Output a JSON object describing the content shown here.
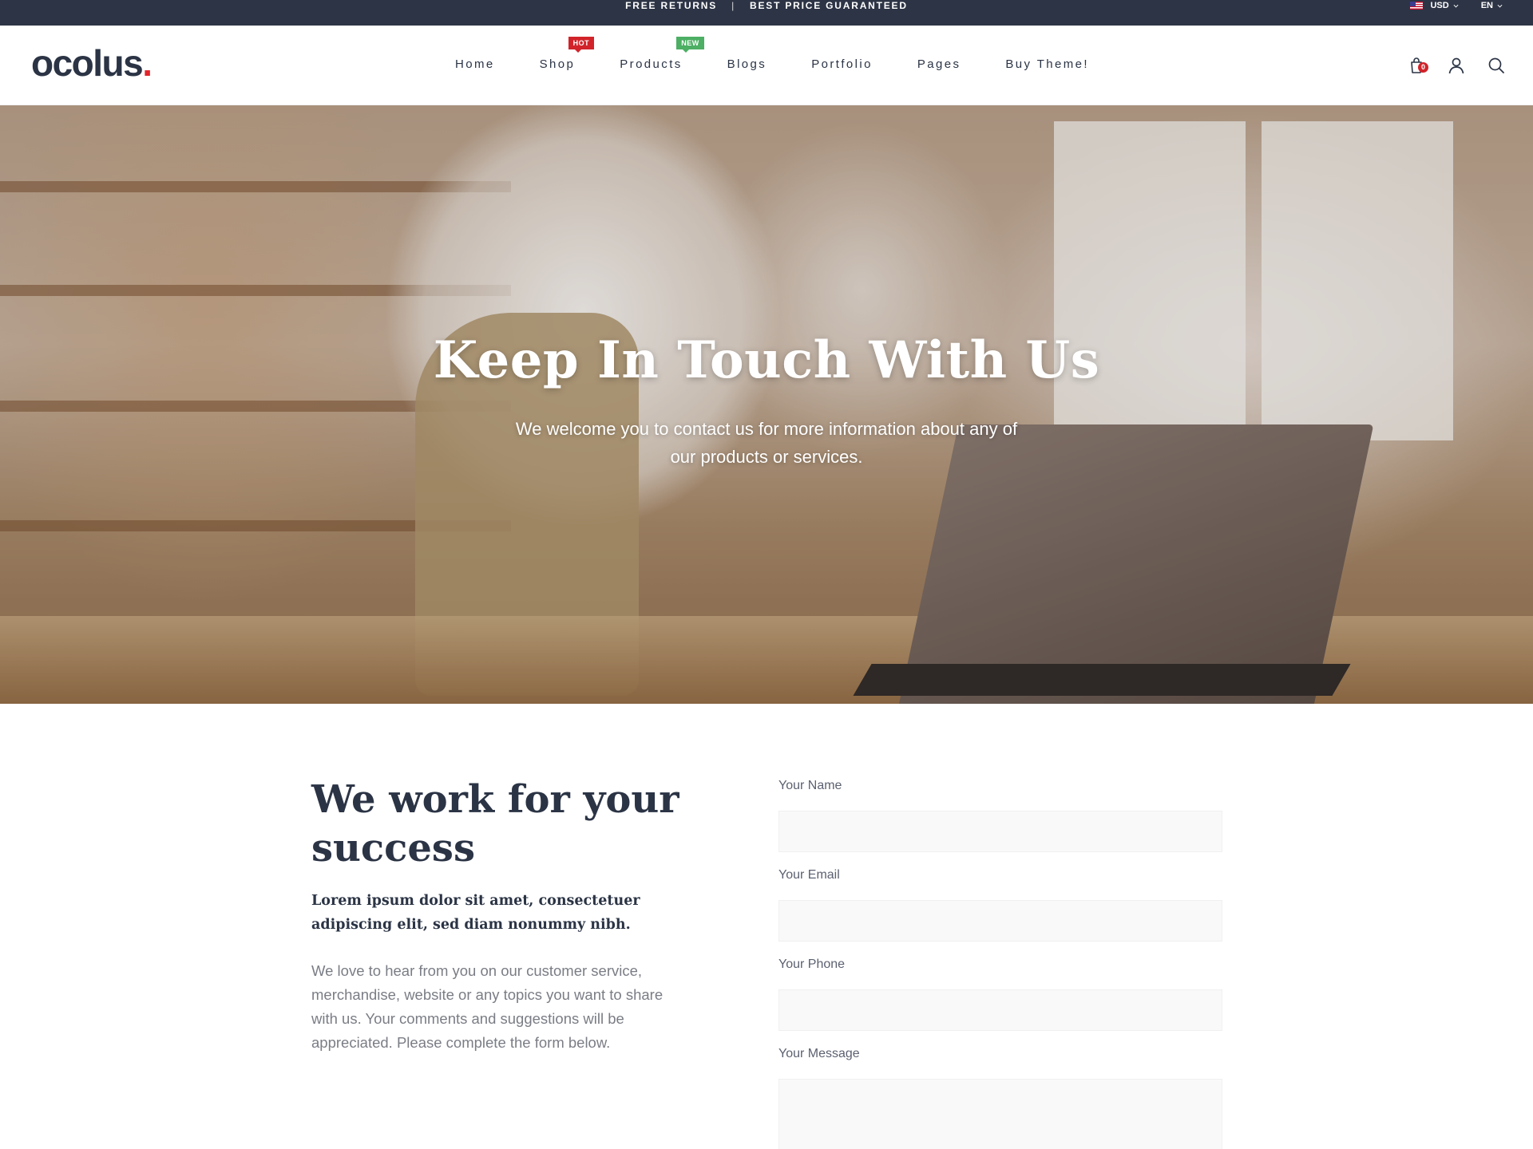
{
  "topbar": {
    "promo_left": "FREE RETURNS",
    "separator": "|",
    "promo_right": "BEST PRICE GUARANTEED",
    "currency": "USD",
    "language": "EN",
    "bg_color": "#2d3445"
  },
  "header": {
    "logo_text": "ocolus",
    "logo_dot": ".",
    "nav": [
      {
        "label": "Home"
      },
      {
        "label": "Shop",
        "badge": "HOT"
      },
      {
        "label": "Products",
        "badge": "NEW"
      },
      {
        "label": "Blogs"
      },
      {
        "label": "Portfolio"
      },
      {
        "label": "Pages"
      },
      {
        "label": "Buy Theme!"
      }
    ],
    "cart_count": "0",
    "icons": [
      "cart-icon",
      "user-icon",
      "search-icon"
    ],
    "badge_colors": {
      "hot": "#d2232a",
      "new": "#4caf63"
    }
  },
  "hero": {
    "title": "Keep In Touch With Us",
    "subtitle": "We welcome you to contact us for more information about any of our products or services."
  },
  "intro": {
    "heading": "We work for your success",
    "lead": "Lorem ipsum dolor sit amet, consectetuer adipiscing elit, sed diam nonummy nibh.",
    "body": "We love to hear from you on our customer service, merchandise, website or any topics you want to share with us. Your comments and suggestions will be appreciated. Please complete the form below."
  },
  "form": {
    "name_label": "Your Name",
    "email_label": "Your Email",
    "phone_label": "Your Phone",
    "message_label": "Your Message",
    "name_value": "",
    "email_value": "",
    "phone_value": "",
    "message_value": ""
  },
  "colors": {
    "text_dark": "#2b3445",
    "accent_red": "#e2242b",
    "muted": "#7a7d85"
  }
}
